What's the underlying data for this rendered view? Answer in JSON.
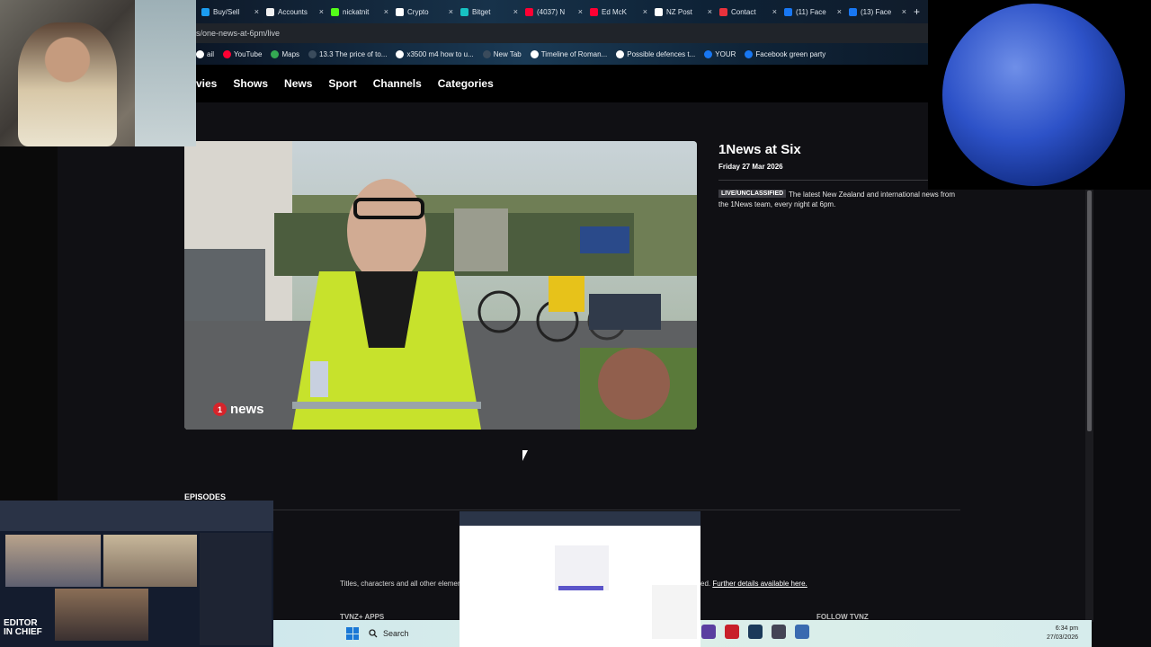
{
  "browser": {
    "tabs": [
      {
        "label": "Buy/Sell",
        "icon": "cryptocurrency-icon",
        "color": "#1b9cf0"
      },
      {
        "label": "Accounts",
        "icon": "accounts-icon",
        "color": "#f0f0f0"
      },
      {
        "label": "nickatnit",
        "icon": "kick-icon",
        "color": "#53fc18"
      },
      {
        "label": "Crypto",
        "icon": "crypto-icon",
        "color": "#ffffff"
      },
      {
        "label": "Bitget",
        "icon": "bitget-icon",
        "color": "#17c2c2"
      },
      {
        "label": "(4037) N",
        "icon": "youtube-icon",
        "color": "#ff0033"
      },
      {
        "label": "Ed McK",
        "icon": "youtube-icon",
        "color": "#ff0033"
      },
      {
        "label": "NZ Post",
        "icon": "nzpost-icon",
        "color": "#ffffff"
      },
      {
        "label": "Contact",
        "icon": "contact-icon",
        "color": "#e8323c"
      },
      {
        "label": "(11) Face",
        "icon": "facebook-icon",
        "color": "#1877f2"
      },
      {
        "label": "(13) Face",
        "icon": "facebook-icon",
        "color": "#1877f2"
      }
    ],
    "new_tab": "+",
    "close_glyph": "×",
    "address": "s/one-news-at-6pm/live",
    "bookmarks": [
      {
        "label": "ail",
        "icon": "mail-icon",
        "color": "#ffffff"
      },
      {
        "label": "YouTube",
        "icon": "youtube-icon",
        "color": "#ff0033"
      },
      {
        "label": "Maps",
        "icon": "maps-icon",
        "color": "#34a853"
      },
      {
        "label": "13.3 The price of to...",
        "icon": "page-icon",
        "color": "#3a4b5c"
      },
      {
        "label": "x3500 m4 how to u...",
        "icon": "google-icon",
        "color": "#ffffff"
      },
      {
        "label": "New Tab",
        "icon": "page-icon",
        "color": "#3a4b5c"
      },
      {
        "label": "Timeline of Roman...",
        "icon": "wikipedia-icon",
        "color": "#ffffff"
      },
      {
        "label": "Possible defences t...",
        "icon": "cl-icon",
        "color": "#ffffff"
      },
      {
        "label": "YOUR",
        "icon": "facebook-icon",
        "color": "#1877f2"
      },
      {
        "label": "Facebook green party",
        "icon": "facebook-icon",
        "color": "#1877f2"
      }
    ]
  },
  "site": {
    "nav": [
      "vies",
      "Shows",
      "News",
      "Sport",
      "Channels",
      "Categories"
    ],
    "show_title": "1News at Six",
    "show_date": "Friday 27 Mar 2026",
    "badge": "LIVE/UNCLASSIFIED",
    "description": "The latest New Zealand and international news from the 1News team, every night at 6pm.",
    "video_brand": "news",
    "video_brand_number": "1",
    "episodes_heading": "EPISODES",
    "copyright_left": "Titles, characters and all other element",
    "copyright_right_prefix": "ed.",
    "copyright_link": "Further details available here.",
    "footer_apps": "TVNZ+ APPS",
    "footer_follow": "FOLLOW TVNZ"
  },
  "taskbar": {
    "search_label": "Search",
    "time": "6:34 pm",
    "date": "27/03/2026"
  },
  "overlays": {
    "editor_label_line1": "EDITOR",
    "editor_label_line2": "IN CHIEF"
  }
}
